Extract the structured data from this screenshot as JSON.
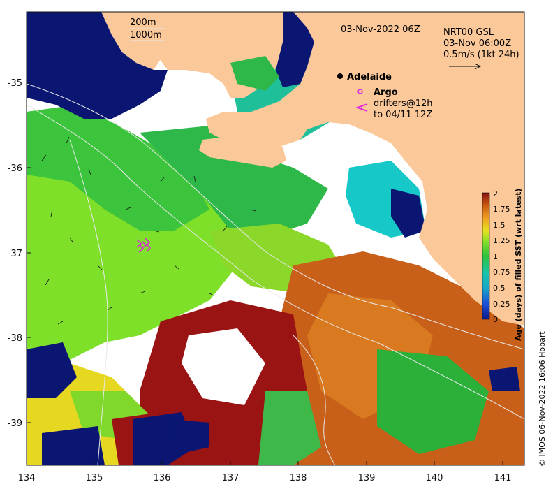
{
  "header": {
    "date": "03-Nov-2022 06Z",
    "product": "NRT00 GSL",
    "time": "03-Nov 06:00Z",
    "scale": "0.5m/s (1kt 24h)"
  },
  "isobaths": {
    "shallow": "200m",
    "deep": "1000m"
  },
  "places": {
    "adelaide": "Adelaide"
  },
  "legend": {
    "argo": "Argo",
    "drifters_line1": "drifters@12h",
    "drifters_line2": "to 04/11 12Z"
  },
  "colorbar": {
    "title": "Age (days) of filled SST (wrt latest)",
    "ticks": [
      "0",
      "0.25",
      "0.5",
      "0.75",
      "1",
      "1.25",
      "1.5",
      "1.75",
      "2"
    ],
    "colors": [
      "#0b1a8a",
      "#1e4fd6",
      "#17a8c9",
      "#19c4a6",
      "#2ec23c",
      "#8be02a",
      "#e6e020",
      "#f0a020",
      "#c85a10",
      "#8b1010"
    ]
  },
  "axes": {
    "x_ticks": [
      "134",
      "135",
      "136",
      "137",
      "138",
      "139",
      "140",
      "141"
    ],
    "y_ticks": [
      "-35",
      "-36",
      "-37",
      "-38",
      "-39"
    ]
  },
  "colors": {
    "land": "#fbc89a",
    "nodata_sea": "#0b1673",
    "argo": "#e020e0",
    "drifters": "#e020e0"
  },
  "credit": "© IMOS 06-Nov-2022 16:06 Hobart"
}
